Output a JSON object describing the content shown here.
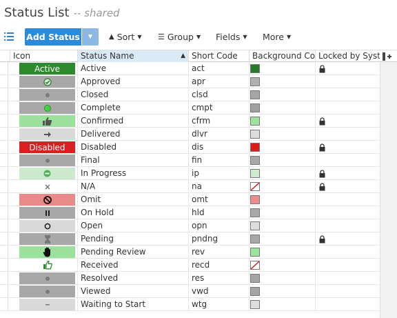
{
  "header": {
    "title": "Status List",
    "subtitle": "-- shared"
  },
  "toolbar": {
    "add_label": "Add Status",
    "sort_label": "Sort",
    "group_label": "Group",
    "fields_label": "Fields",
    "more_label": "More"
  },
  "columns": [
    "Icon",
    "Status Name",
    "Short Code",
    "Background Co...",
    "Locked by Syst..."
  ],
  "colors": {
    "accent": "#2b8ad9",
    "accent_light": "#8cb8e4",
    "sorted_header": "#dbeaf7"
  },
  "rows": [
    {
      "name": "Active",
      "code": "act",
      "icon_bg": "#2d8a2d",
      "icon_text": "Active",
      "icon_glyph": "",
      "icon_color": "#fff",
      "swatch": "#277a27",
      "locked": true
    },
    {
      "name": "Approved",
      "code": "apr",
      "icon_bg": "#a8a8a8",
      "icon_text": "",
      "icon_glyph": "check-circle-icon",
      "icon_color": "#2e7d32",
      "swatch": "#b0b0b0",
      "locked": false
    },
    {
      "name": "Closed",
      "code": "clsd",
      "icon_bg": "#a8a8a8",
      "icon_text": "",
      "icon_glyph": "dot-icon",
      "icon_color": "#777",
      "swatch": "#a6a6a6",
      "locked": false
    },
    {
      "name": "Complete",
      "code": "cmpt",
      "icon_bg": "#a8a8a8",
      "icon_text": "",
      "icon_glyph": "green-dot-icon",
      "icon_color": "#3ccc3c",
      "swatch": "#a0a0a0",
      "locked": false
    },
    {
      "name": "Confirmed",
      "code": "cfrm",
      "icon_bg": "#9be09b",
      "icon_text": "",
      "icon_glyph": "thumbs-up-icon",
      "icon_color": "#555",
      "swatch": "#9de39d",
      "locked": true
    },
    {
      "name": "Delivered",
      "code": "dlvr",
      "icon_bg": "#d9d9d9",
      "icon_text": "",
      "icon_glyph": "arrow-right-icon",
      "icon_color": "#555",
      "swatch": "#dddddd",
      "locked": false
    },
    {
      "name": "Disabled",
      "code": "dis",
      "icon_bg": "#d92020",
      "icon_text": "Disabled",
      "icon_glyph": "",
      "icon_color": "#fff",
      "swatch": "#d91d1d",
      "locked": true
    },
    {
      "name": "Final",
      "code": "fin",
      "icon_bg": "#a8a8a8",
      "icon_text": "",
      "icon_glyph": "dot-icon",
      "icon_color": "#777",
      "swatch": "#a8a8a8",
      "locked": false
    },
    {
      "name": "In Progress",
      "code": "ip",
      "icon_bg": "#cde9cd",
      "icon_text": "",
      "icon_glyph": "progress-circle-icon",
      "icon_color": "#3a9a3a",
      "swatch": "#cdeccd",
      "locked": true
    },
    {
      "name": "N/A",
      "code": "na",
      "icon_bg": "#ffffff",
      "icon_text": "",
      "icon_glyph": "x-icon",
      "icon_color": "#777",
      "swatch": "none",
      "locked": true
    },
    {
      "name": "Omit",
      "code": "omt",
      "icon_bg": "#e98a8a",
      "icon_text": "",
      "icon_glyph": "no-entry-icon",
      "icon_color": "#222",
      "swatch": "#ec8c8c",
      "locked": false
    },
    {
      "name": "On Hold",
      "code": "hld",
      "icon_bg": "#a8a8a8",
      "icon_text": "",
      "icon_glyph": "pause-icon",
      "icon_color": "#222",
      "swatch": "#a8a8a8",
      "locked": false
    },
    {
      "name": "Open",
      "code": "opn",
      "icon_bg": "#d9d9d9",
      "icon_text": "",
      "icon_glyph": "ring-icon",
      "icon_color": "#222",
      "swatch": "#dddddd",
      "locked": false
    },
    {
      "name": "Pending",
      "code": "pndng",
      "icon_bg": "#a8a8a8",
      "icon_text": "",
      "icon_glyph": "hourglass-icon",
      "icon_color": "#666",
      "swatch": "#a8a8a8",
      "locked": true
    },
    {
      "name": "Pending Review",
      "code": "rev",
      "icon_bg": "#9be09b",
      "icon_text": "",
      "icon_glyph": "hand-icon",
      "icon_color": "#222",
      "swatch": "#9de39d",
      "locked": false
    },
    {
      "name": "Received",
      "code": "recd",
      "icon_bg": "#ffffff",
      "icon_text": "",
      "icon_glyph": "thumbs-up-outline-icon",
      "icon_color": "#2e8b2e",
      "swatch": "none",
      "locked": false
    },
    {
      "name": "Resolved",
      "code": "res",
      "icon_bg": "#a8a8a8",
      "icon_text": "",
      "icon_glyph": "dot-icon",
      "icon_color": "#777",
      "swatch": "#a4a4a4",
      "locked": false
    },
    {
      "name": "Viewed",
      "code": "vwd",
      "icon_bg": "#a8a8a8",
      "icon_text": "",
      "icon_glyph": "dot-icon",
      "icon_color": "#777",
      "swatch": "#a4a4a4",
      "locked": false
    },
    {
      "name": "Waiting to Start",
      "code": "wtg",
      "icon_bg": "#d9d9d9",
      "icon_text": "",
      "icon_glyph": "dash-icon",
      "icon_color": "#777",
      "swatch": "#dddddd",
      "locked": false
    }
  ]
}
